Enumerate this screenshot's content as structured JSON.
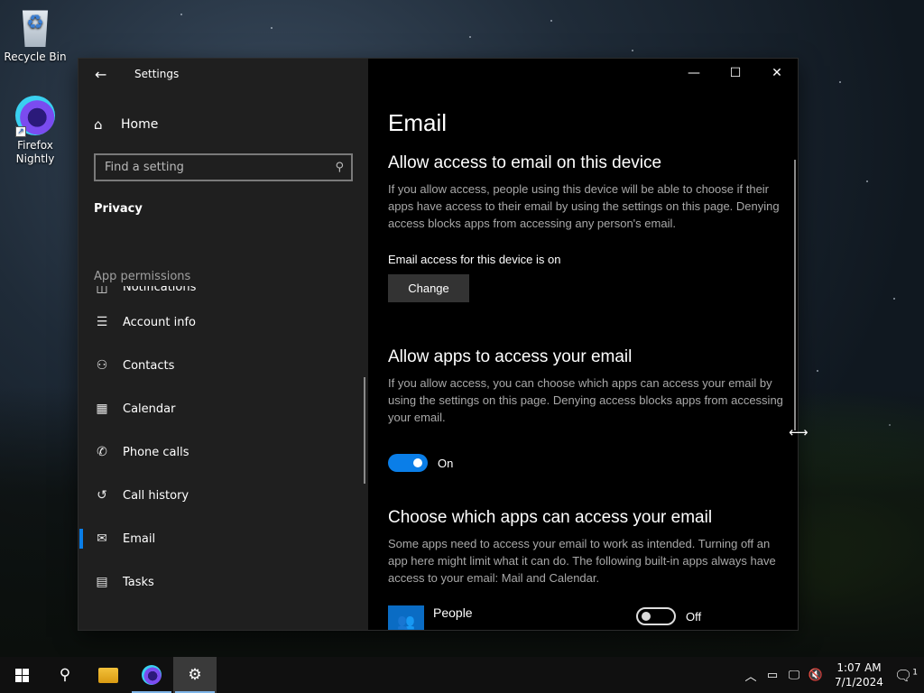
{
  "desktop": {
    "icons": [
      {
        "label": "Recycle Bin"
      },
      {
        "label": "Firefox Nightly"
      }
    ]
  },
  "window": {
    "title": "Settings",
    "home_label": "Home",
    "search_placeholder": "Find a setting",
    "section_title": "Privacy",
    "group_title": "App permissions",
    "nav_items": [
      {
        "label": "Notifications",
        "icon": "notifications-icon"
      },
      {
        "label": "Account info",
        "icon": "account-info-icon"
      },
      {
        "label": "Contacts",
        "icon": "contacts-icon"
      },
      {
        "label": "Calendar",
        "icon": "calendar-icon"
      },
      {
        "label": "Phone calls",
        "icon": "phone-icon"
      },
      {
        "label": "Call history",
        "icon": "history-icon"
      },
      {
        "label": "Email",
        "icon": "mail-icon",
        "active": true
      },
      {
        "label": "Tasks",
        "icon": "tasks-icon"
      }
    ]
  },
  "page": {
    "title": "Email",
    "device_section": {
      "heading": "Allow access to email on this device",
      "description": "If you allow access, people using this device will be able to choose if their apps have access to their email by using the settings on this page. Denying access blocks apps from accessing any person's email.",
      "status": "Email access for this device is on",
      "change_button": "Change"
    },
    "apps_section": {
      "heading": "Allow apps to access your email",
      "description": "If you allow access, you can choose which apps can access your email by using the settings on this page. Denying access blocks apps from accessing your email.",
      "toggle_state": "On"
    },
    "choose_section": {
      "heading": "Choose which apps can access your email",
      "description": "Some apps need to access your email to work as intended. Turning off an app here might limit what it can do. The following built-in apps always have access to your email: Mail and Calendar."
    },
    "apps": [
      {
        "name": "People",
        "toggle_state": "Off"
      }
    ]
  },
  "taskbar": {
    "time": "1:07 AM",
    "date": "7/1/2024",
    "notification_count": "1"
  },
  "colors": {
    "accent": "#0a7ee8",
    "sidebar_bg": "#1f1f1f",
    "main_bg": "#000000"
  }
}
